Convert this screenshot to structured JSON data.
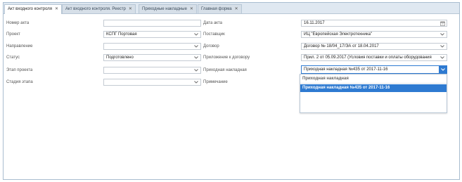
{
  "tabs": [
    {
      "label": "Акт входного контроля",
      "close": "✕"
    },
    {
      "label": "Акт входного контроля. Реестр",
      "close": "✕"
    },
    {
      "label": "Приходные накладные",
      "close": "✕"
    },
    {
      "label": "Главная форма",
      "close": "✕"
    }
  ],
  "left_form": {
    "act_number_label": "Номер акта",
    "act_number_value": "",
    "project_label": "Проект",
    "project_value": "КСПГ Портовая",
    "direction_label": "Направление",
    "direction_value": "",
    "status_label": "Статус",
    "status_value": "Подготовлено",
    "project_stage_label": "Этап проекта",
    "project_stage_value": "",
    "stage_phase_label": "Стадия этапа",
    "stage_phase_value": ""
  },
  "right_form": {
    "act_date_label": "Дата акта",
    "act_date_value": "16.11.2017",
    "supplier_label": "Поставщик",
    "supplier_value": "ИЦ \"Европейская Электротехника\"",
    "contract_label": "Договор",
    "contract_value": "Договор № 18/04_17/ЭА от 18.04.2017",
    "contract_appendix_label": "Приложение к договору",
    "contract_appendix_value": "Прил. 2 от 05.09.2017 (Условия поставки и оплаты оборудования",
    "invoice_label": "Приходная накладная",
    "invoice_value": "Приходная накладная №435 от 2017-11-16",
    "note_label": "Примечание"
  },
  "dropdown": {
    "header": "Приходная накладная",
    "items": [
      "Приходная накладная №435 от 2017-11-16"
    ]
  },
  "icons": {
    "calendar": "calendar-icon",
    "chevron": "chevron-down-icon"
  },
  "colors": {
    "accent": "#2e7ad1",
    "tabbar": "#dfe8f1"
  }
}
